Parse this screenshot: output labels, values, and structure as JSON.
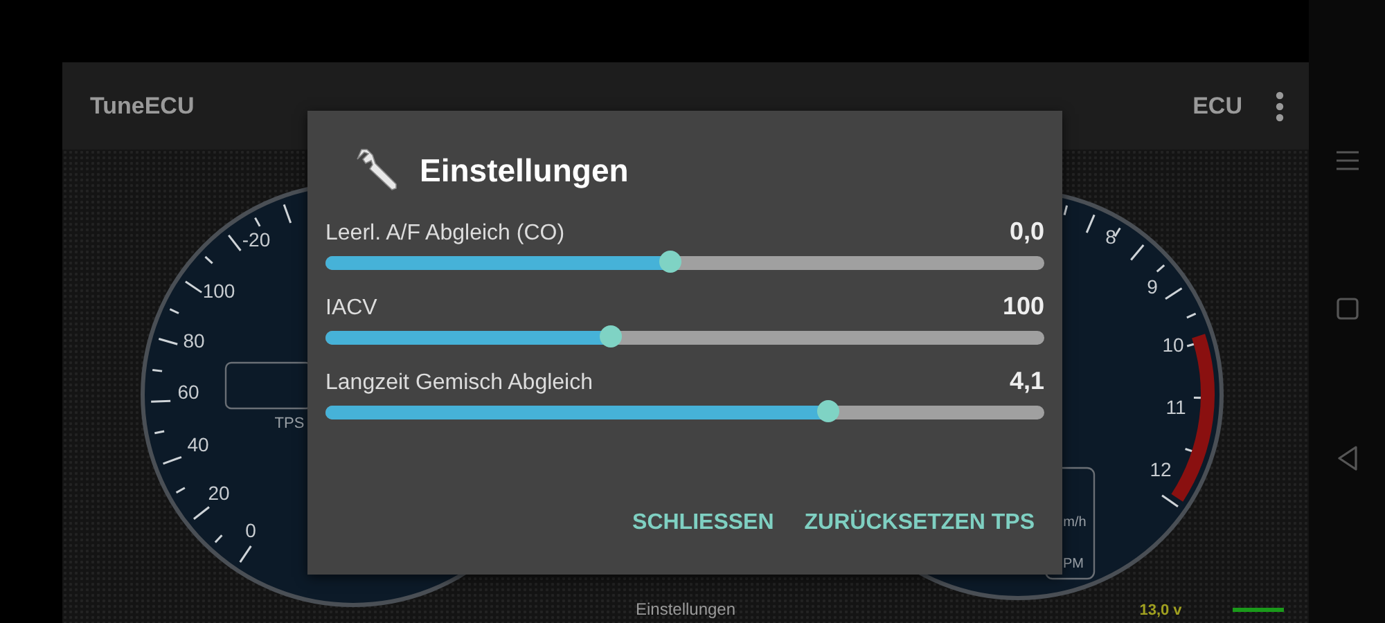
{
  "app_bar": {
    "title": "TuneECU",
    "action": "ECU"
  },
  "gauges": [
    {
      "labels": [
        "-20",
        "100",
        "80",
        "60",
        "40",
        "20",
        "0"
      ],
      "caption": "TPS"
    },
    {
      "labels": [
        "8",
        "9",
        "10",
        "11",
        "12"
      ],
      "readouts": [
        "m/h",
        "PM"
      ]
    }
  ],
  "status": {
    "label": "Einstellungen",
    "voltage": "13,0 v"
  },
  "dialog": {
    "title": "Einstellungen",
    "settings": [
      {
        "label": "Leerl. A/F Abgleich (CO)",
        "value": "0,0",
        "level": 0.48
      },
      {
        "label": "IACV",
        "value": "100",
        "level": 0.397
      },
      {
        "label": "Langzeit Gemisch Abgleich",
        "value": "4,1",
        "level": 0.7
      }
    ],
    "buttons": [
      "SCHLIESSEN",
      "ZURÜCKSETZEN TPS"
    ]
  }
}
